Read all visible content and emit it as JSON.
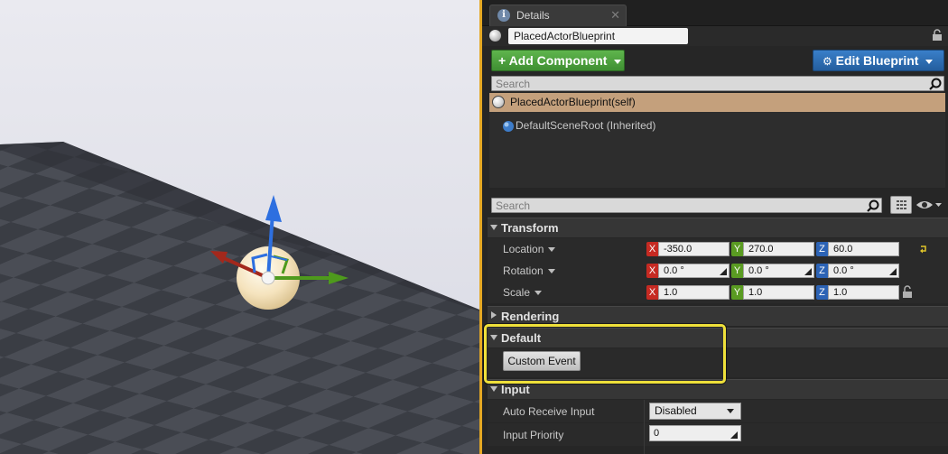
{
  "details_tab": {
    "label": "Details"
  },
  "actor": {
    "name": "PlacedActorBlueprint"
  },
  "toolbar": {
    "add_component_label": "Add Component",
    "edit_blueprint_label": "Edit Blueprint"
  },
  "component_search": {
    "placeholder": "Search"
  },
  "components": [
    {
      "label": "PlacedActorBlueprint(self)"
    },
    {
      "label": "DefaultSceneRoot (Inherited)"
    }
  ],
  "details_search": {
    "placeholder": "Search"
  },
  "sections": {
    "transform": "Transform",
    "rendering": "Rendering",
    "default": "Default",
    "input": "Input"
  },
  "transform": {
    "location": {
      "label": "Location",
      "x": "-350.0",
      "y": "270.0",
      "z": "60.0"
    },
    "rotation": {
      "label": "Rotation",
      "x": "0.0 °",
      "y": "0.0 °",
      "z": "0.0 °"
    },
    "scale": {
      "label": "Scale",
      "x": "1.0",
      "y": "1.0",
      "z": "1.0"
    }
  },
  "axis_letters": {
    "x": "X",
    "y": "Y",
    "z": "Z"
  },
  "default": {
    "custom_event_label": "Custom Event"
  },
  "input": {
    "auto_receive_label": "Auto Receive Input",
    "auto_receive_value": "Disabled",
    "priority_label": "Input Priority",
    "priority_value": "0"
  },
  "colors": {
    "accent_border": "#e5a823",
    "highlight": "#efe03a",
    "add_component": "#4ea83f",
    "edit_blueprint": "#2f6fb3",
    "selected_component": "#c4a07c"
  },
  "icons": [
    "info-icon",
    "close-icon",
    "lock-icon",
    "search-icon",
    "grid-view-icon",
    "eye-icon",
    "sphere-icon",
    "reset-arrow-icon",
    "gear-icon"
  ]
}
